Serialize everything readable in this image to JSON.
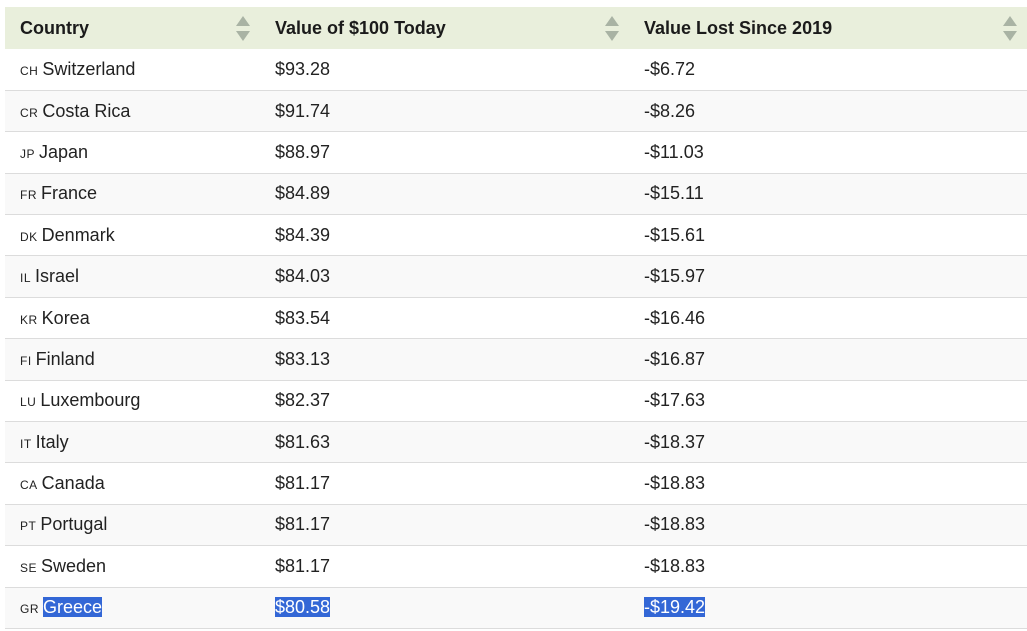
{
  "table": {
    "headers": [
      "Country",
      "Value of $100 Today",
      "Value Lost Since 2019"
    ],
    "rows": [
      {
        "code": "CH",
        "country": "Switzerland",
        "value": "$93.28",
        "lost": "-$6.72"
      },
      {
        "code": "CR",
        "country": "Costa Rica",
        "value": "$91.74",
        "lost": "-$8.26"
      },
      {
        "code": "JP",
        "country": "Japan",
        "value": "$88.97",
        "lost": "-$11.03"
      },
      {
        "code": "FR",
        "country": "France",
        "value": "$84.89",
        "lost": "-$15.11"
      },
      {
        "code": "DK",
        "country": "Denmark",
        "value": "$84.39",
        "lost": "-$15.61"
      },
      {
        "code": "IL",
        "country": "Israel",
        "value": "$84.03",
        "lost": "-$15.97"
      },
      {
        "code": "KR",
        "country": "Korea",
        "value": "$83.54",
        "lost": "-$16.46"
      },
      {
        "code": "FI",
        "country": "Finland",
        "value": "$83.13",
        "lost": "-$16.87"
      },
      {
        "code": "LU",
        "country": "Luxembourg",
        "value": "$82.37",
        "lost": "-$17.63"
      },
      {
        "code": "IT",
        "country": "Italy",
        "value": "$81.63",
        "lost": "-$18.37"
      },
      {
        "code": "CA",
        "country": "Canada",
        "value": "$81.17",
        "lost": "-$18.83"
      },
      {
        "code": "PT",
        "country": "Portugal",
        "value": "$81.17",
        "lost": "-$18.83"
      },
      {
        "code": "SE",
        "country": "Sweden",
        "value": "$81.17",
        "lost": "-$18.83"
      },
      {
        "code": "GR",
        "country": "Greece",
        "value": "$80.58",
        "lost": "-$19.42"
      }
    ],
    "selected_row_index": 13,
    "sort_icon": "sort-arrows-icon",
    "colors": {
      "header_bg": "#e9efdc",
      "selection": "#3367d6",
      "sort_icon": "#a9b3a4"
    }
  }
}
